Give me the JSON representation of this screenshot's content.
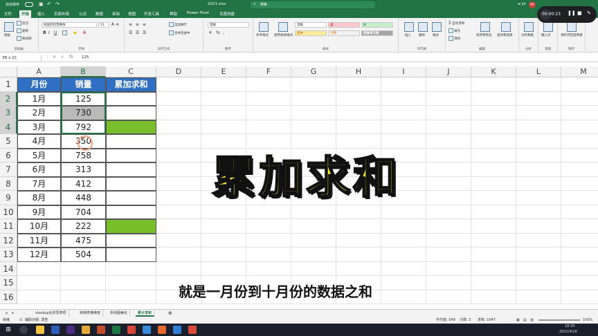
{
  "titlebar": {
    "autosave": "自动保存",
    "filename": "2021.xlsx",
    "search": "搜索",
    "user": "w yh",
    "avatar": "WY"
  },
  "recorder": {
    "time": "00:00:23",
    "pause": "❚❚",
    "stop": "■",
    "pen": "✎"
  },
  "tabs": [
    "文件",
    "开始",
    "插入",
    "页面布局",
    "公式",
    "数据",
    "审阅",
    "视图",
    "开发工具",
    "帮助",
    "Power Pivot",
    "百度网盘"
  ],
  "ribbon": {
    "clipboard": {
      "label": "剪贴板",
      "paste": "粘贴",
      "cut": "剪切",
      "copy": "复制",
      "format": "格式刷"
    },
    "font": {
      "label": "字体",
      "name": "阿里巴巴普惠体",
      "size": "11"
    },
    "align": {
      "label": "对齐方式",
      "wrap": "自动换行",
      "merge": "合并后居中"
    },
    "number": {
      "label": "数字",
      "format": "常规"
    },
    "styles": {
      "label": "样式",
      "cond": "条件格式",
      "table": "套用表格格式",
      "normal": "常规",
      "bad": "差",
      "good": "好",
      "neutral": "适中",
      "calc": "计算",
      "check": "检查单元格"
    },
    "cells": {
      "label": "单元格",
      "insert": "插入",
      "delete": "删除",
      "format": "格式"
    },
    "edit": {
      "label": "编辑",
      "autosum": "自动求和",
      "fill": "填充",
      "clear": "清除",
      "sort": "排序和筛选",
      "find": "查找和选择"
    },
    "analysis": {
      "label": "分析",
      "btn": "分析数据"
    },
    "sketch": {
      "label": "草图",
      "btn": "输入对"
    },
    "save": {
      "label": "保存",
      "btn": "保存到百度网盘"
    }
  },
  "formula": {
    "namebox": "3R x 1C",
    "value": "125"
  },
  "columns": [
    "A",
    "B",
    "C",
    "D",
    "E",
    "F",
    "G",
    "H",
    "I",
    "J",
    "K",
    "L",
    "M"
  ],
  "rows": [
    "1",
    "2",
    "3",
    "4",
    "5",
    "6",
    "7",
    "8",
    "9",
    "10",
    "11",
    "12",
    "13",
    "14",
    "15",
    "16"
  ],
  "table": {
    "headers": [
      "月份",
      "销量",
      "累加求和"
    ],
    "rows": [
      [
        "1月",
        "125"
      ],
      [
        "2月",
        "730"
      ],
      [
        "3月",
        "792"
      ],
      [
        "4月",
        "350"
      ],
      [
        "5月",
        "758"
      ],
      [
        "6月",
        "313"
      ],
      [
        "7月",
        "412"
      ],
      [
        "8月",
        "448"
      ],
      [
        "9月",
        "704"
      ],
      [
        "10月",
        "222"
      ],
      [
        "11月",
        "475"
      ],
      [
        "12月",
        "504"
      ]
    ]
  },
  "overlay": {
    "title": "累加求和",
    "subtitle": "就是一月份到十月份的数据之和"
  },
  "sheets": [
    "vlookup合并同类项",
    "转换表格维度",
    "折线图美化",
    "累计求和"
  ],
  "status": {
    "ready": "就绪",
    "access": "辅助功能: 调查",
    "avg": "平均值: 549",
    "count": "计数: 3",
    "sum": "求和: 1647",
    "zoom": "100%"
  },
  "taskbar": {
    "time": "18:30",
    "date": "2021/4/18"
  }
}
